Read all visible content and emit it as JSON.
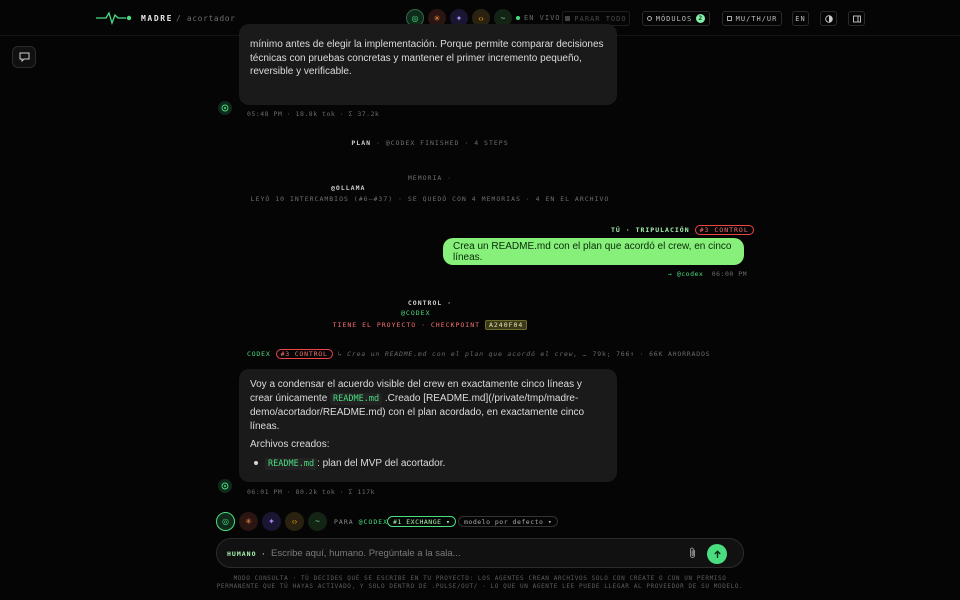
{
  "header": {
    "brand": "MADRE",
    "crumb": "/ acortador",
    "live_label": "EN VIVO",
    "stop_label": "PARAR TODO",
    "modules_label": "MÓDULOS",
    "modules_count": "2",
    "layout_label": "MU/TH/UR",
    "lang_label": "EN"
  },
  "messages": {
    "first": {
      "text": "mínimo antes de elegir la implementación. Porque permite comparar decisiones técnicas con pruebas concretas y mantener el primer incremento pequeño, reversible y verificable.",
      "meta": "05:48 PM · 18.8k tok · Σ 37.2k"
    },
    "plan": {
      "label": "PLAN",
      "rest": " · @CODEX FINISHED · 4 STEPS"
    },
    "memoria": {
      "title": "MEMORIA ·",
      "agent": "@OLLAMA",
      "detail": "LEYÓ 10 INTERCAMBIOS (#6–#37) · SE QUEDÓ CON 4 MEMORIAS · 4 EN EL ARCHIVO"
    },
    "user": {
      "header": "TÚ · TRIPULACIÓN",
      "tag": "#3 CONTROL",
      "text": "Crea un README.md con el plan que acordó el crew, en cinco líneas.",
      "meta_agent": "→ @codex",
      "meta_time": "06:00 PM"
    },
    "control": {
      "title": "CONTROL ·",
      "agent": "@CODEX",
      "line": "TIENE EL PROYECTO · CHECKPOINT",
      "checkpoint": "A240F04"
    },
    "codex": {
      "label": "CODEX",
      "tag": "#3 CONTROL",
      "reply_preview": "↳ Crea un README.md con el plan que acordó el crew, …",
      "stats": "79k; 766↑ · 66K AHORRADOS",
      "p1a": "Voy a condensar el acuerdo visible del crew en exactamente cinco líneas y crear únicamente",
      "code1": "README.md",
      "p1b": ".Creado [README.md](/private/tmp/madre-demo/acortador/README.md) con el plan acordado, en exactamente cinco líneas.",
      "p2": "Archivos creados:",
      "li_code": "README.md",
      "li_text": ": plan del MVP del acortador.",
      "meta": "06:01 PM · 80.2k tok · Σ 117k"
    }
  },
  "composer": {
    "para": "PARA",
    "target": "@CODEX",
    "exchange": "#1 EXCHANGE ▾",
    "model": "modelo por defecto ▾",
    "humano": "HUMANO ·",
    "placeholder": "Escribe aquí, humano. Pregúntale a la sala..."
  },
  "footer": "MODO CONSULTA · TÚ DECIDES QUÉ SE ESCRIBE EN TU PROYECTO: LOS AGENTES CREAN ARCHIVOS SOLO CON CREATE O CON UN PERMISO PERMANENTE QUE TÚ HAYAS ACTIVADO, Y SOLO DENTRO DE .PULSE/OUT/ · LO QUE UN AGENTE LEE PUEDE LLEGAR AL PROVEEDOR DE SU MODELO.",
  "colors": {
    "accent": "#4ade80",
    "user_bubble": "#86f07a",
    "control_red": "#ef4444"
  }
}
